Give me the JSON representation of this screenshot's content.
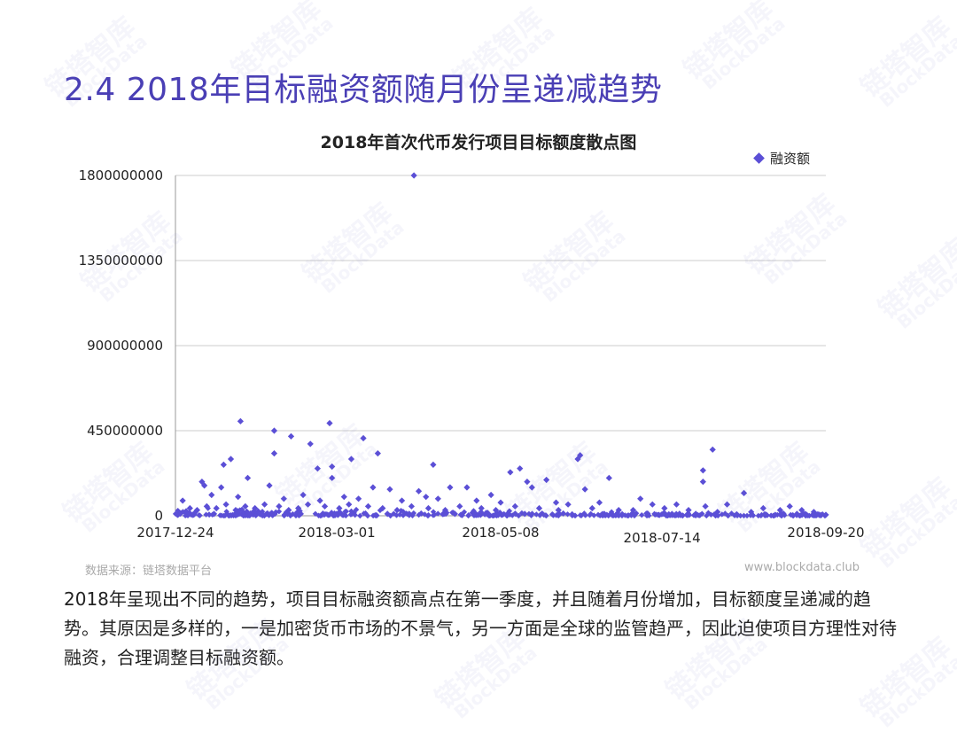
{
  "page_title": "2.4 2018年目标融资额随月份呈递减趋势",
  "source": "数据来源：链塔数据平台",
  "website": "www.blockdata.club",
  "body_text": "2018年呈现出不同的趋势，项目目标融资额高点在第一季度，并且随着月份增加，目标额度呈递减的趋势。其原因是多样的，一是加密货币市场的不景气，另一方面是全球的监管趋严，因此迫使项目方理性对待融资，合理调整目标融资额。",
  "watermark_text": "链塔智库",
  "watermark_sub": "BlockData",
  "colors": {
    "title": "#4a3fb5",
    "marker": "#5b4fd6",
    "grid": "#cccccc"
  },
  "chart_data": {
    "type": "scatter",
    "title": "2018年首次代币发行项目目标额度散点图",
    "legend": {
      "label": "融资额",
      "position": "top-right"
    },
    "xlabel": "",
    "ylabel": "",
    "ylim": [
      0,
      1800000000
    ],
    "y_ticks": [
      "0",
      "450000000",
      "900000000",
      "1350000000",
      "1800000000"
    ],
    "y_tick_values": [
      0,
      450000000,
      900000000,
      1350000000,
      1800000000
    ],
    "xlim": [
      "2017-12-24",
      "2018-09-20"
    ],
    "x_ticks": [
      "2017-12-24",
      "2018-03-01",
      "2018-05-08",
      "2018-07-14",
      "2018-09-20"
    ],
    "grid": true,
    "series": [
      {
        "name": "融资额",
        "points": [
          [
            "2018-01-20",
            500000000
          ],
          [
            "2018-02-03",
            450000000
          ],
          [
            "2018-02-10",
            420000000
          ],
          [
            "2018-02-18",
            380000000
          ],
          [
            "2018-02-26",
            490000000
          ],
          [
            "2018-03-12",
            410000000
          ],
          [
            "2018-03-18",
            330000000
          ],
          [
            "2018-03-07",
            300000000
          ],
          [
            "2018-04-02",
            1800000000
          ],
          [
            "2018-04-10",
            270000000
          ],
          [
            "2018-05-16",
            250000000
          ],
          [
            "2018-06-10",
            320000000
          ],
          [
            "2018-06-09",
            300000000
          ],
          [
            "2018-08-04",
            350000000
          ],
          [
            "2018-07-31",
            240000000
          ],
          [
            "2018-01-16",
            300000000
          ],
          [
            "2018-01-13",
            270000000
          ],
          [
            "2018-02-03",
            330000000
          ],
          [
            "2018-03-16",
            150000000
          ],
          [
            "2018-01-04",
            180000000
          ],
          [
            "2018-01-05",
            160000000
          ],
          [
            "2018-01-12",
            150000000
          ],
          [
            "2018-01-23",
            200000000
          ],
          [
            "2018-02-01",
            160000000
          ],
          [
            "2018-02-21",
            250000000
          ],
          [
            "2018-02-27",
            260000000
          ],
          [
            "2018-02-27",
            200000000
          ],
          [
            "2018-03-04",
            100000000
          ],
          [
            "2018-03-23",
            140000000
          ],
          [
            "2018-04-04",
            130000000
          ],
          [
            "2018-04-07",
            100000000
          ],
          [
            "2018-04-17",
            150000000
          ],
          [
            "2018-04-24",
            150000000
          ],
          [
            "2018-05-04",
            110000000
          ],
          [
            "2018-05-12",
            230000000
          ],
          [
            "2018-05-19",
            180000000
          ],
          [
            "2018-05-21",
            150000000
          ],
          [
            "2018-05-27",
            190000000
          ],
          [
            "2018-06-12",
            140000000
          ],
          [
            "2018-06-22",
            200000000
          ],
          [
            "2018-07-05",
            90000000
          ],
          [
            "2018-07-31",
            180000000
          ],
          [
            "2018-08-17",
            120000000
          ],
          [
            "2018-09-05",
            50000000
          ],
          [
            "2017-12-27",
            80000000
          ],
          [
            "2018-01-08",
            110000000
          ],
          [
            "2018-01-19",
            100000000
          ],
          [
            "2018-02-07",
            90000000
          ],
          [
            "2018-02-15",
            110000000
          ],
          [
            "2018-02-22",
            80000000
          ],
          [
            "2018-03-10",
            90000000
          ],
          [
            "2018-03-28",
            80000000
          ],
          [
            "2018-04-12",
            90000000
          ],
          [
            "2018-04-28",
            80000000
          ],
          [
            "2018-05-08",
            70000000
          ],
          [
            "2018-05-31",
            70000000
          ],
          [
            "2018-06-05",
            60000000
          ],
          [
            "2018-06-18",
            70000000
          ],
          [
            "2018-07-10",
            60000000
          ],
          [
            "2018-07-20",
            60000000
          ],
          [
            "2018-08-01",
            50000000
          ],
          [
            "2018-08-10",
            60000000
          ],
          [
            "2018-08-25",
            40000000
          ],
          [
            "2018-09-01",
            30000000
          ],
          [
            "2018-09-10",
            30000000
          ],
          [
            "2018-09-15",
            20000000
          ],
          [
            "2017-12-30",
            40000000
          ],
          [
            "2018-01-02",
            30000000
          ],
          [
            "2018-01-06",
            50000000
          ],
          [
            "2018-01-10",
            40000000
          ],
          [
            "2018-01-14",
            60000000
          ],
          [
            "2018-01-18",
            30000000
          ],
          [
            "2018-01-22",
            50000000
          ],
          [
            "2018-01-26",
            40000000
          ],
          [
            "2018-01-30",
            60000000
          ],
          [
            "2018-02-05",
            50000000
          ],
          [
            "2018-02-09",
            30000000
          ],
          [
            "2018-02-13",
            40000000
          ],
          [
            "2018-02-17",
            60000000
          ],
          [
            "2018-02-24",
            50000000
          ],
          [
            "2018-03-02",
            40000000
          ],
          [
            "2018-03-06",
            60000000
          ],
          [
            "2018-03-14",
            50000000
          ],
          [
            "2018-03-20",
            40000000
          ],
          [
            "2018-03-26",
            30000000
          ],
          [
            "2018-04-01",
            50000000
          ],
          [
            "2018-04-08",
            40000000
          ],
          [
            "2018-04-15",
            30000000
          ],
          [
            "2018-04-21",
            50000000
          ],
          [
            "2018-04-30",
            40000000
          ],
          [
            "2018-05-06",
            30000000
          ],
          [
            "2018-05-14",
            50000000
          ],
          [
            "2018-05-24",
            40000000
          ],
          [
            "2018-06-01",
            30000000
          ],
          [
            "2018-06-15",
            40000000
          ],
          [
            "2018-06-26",
            30000000
          ],
          [
            "2018-07-02",
            30000000
          ],
          [
            "2018-07-15",
            40000000
          ],
          [
            "2018-07-25",
            30000000
          ],
          [
            "2018-08-06",
            20000000
          ],
          [
            "2018-08-20",
            20000000
          ],
          [
            "2018-09-08",
            10000000
          ],
          [
            "2018-01-01",
            15000000
          ],
          [
            "2018-01-09",
            10000000
          ],
          [
            "2018-01-21",
            12000000
          ],
          [
            "2018-02-02",
            15000000
          ],
          [
            "2018-02-14",
            10000000
          ],
          [
            "2018-02-28",
            12000000
          ],
          [
            "2018-03-08",
            15000000
          ],
          [
            "2018-03-22",
            10000000
          ],
          [
            "2018-04-05",
            12000000
          ],
          [
            "2018-04-19",
            10000000
          ],
          [
            "2018-05-02",
            15000000
          ],
          [
            "2018-05-18",
            10000000
          ],
          [
            "2018-06-03",
            12000000
          ],
          [
            "2018-06-20",
            10000000
          ],
          [
            "2018-07-08",
            12000000
          ],
          [
            "2018-07-28",
            10000000
          ],
          [
            "2018-08-14",
            8000000
          ],
          [
            "2018-08-30",
            5000000
          ],
          [
            "2018-09-12",
            5000000
          ],
          [
            "2018-09-18",
            3000000
          ],
          [
            "2018-09-20",
            5000000
          ]
        ]
      }
    ]
  }
}
